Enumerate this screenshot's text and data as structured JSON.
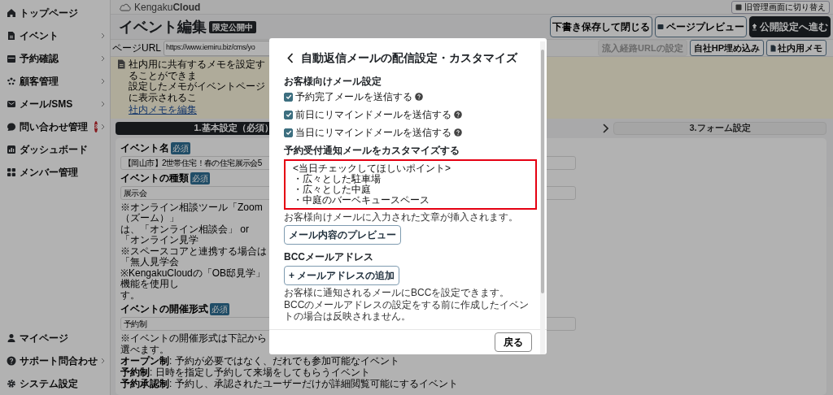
{
  "sidebar": {
    "items": [
      {
        "label": "トップページ",
        "expandable": false
      },
      {
        "label": "イベント",
        "expandable": true
      },
      {
        "label": "予約確認",
        "expandable": true
      },
      {
        "label": "顧客管理",
        "expandable": true
      },
      {
        "label": "メール/SMS",
        "expandable": true
      },
      {
        "label": "問い合わせ管理",
        "expandable": true,
        "badge": "3"
      },
      {
        "label": "ダッシュボード",
        "expandable": false
      },
      {
        "label": "メンバー管理",
        "expandable": false
      }
    ],
    "bottom_items": [
      {
        "label": "マイページ",
        "expandable": false
      },
      {
        "label": "サポート問合わせ",
        "expandable": true
      },
      {
        "label": "システム設定",
        "expandable": false
      }
    ]
  },
  "header": {
    "logo": "Kengaku**Cloud**",
    "switch_button": "旧管理画面に切り替え"
  },
  "page": {
    "title": "イベント編集",
    "status_badge": "限定公開中",
    "actions": [
      {
        "label": "下書き保存して閉じる",
        "kind": "outline"
      },
      {
        "label": "ページプレビュー",
        "kind": "preview"
      },
      {
        "label": "公開設定へ進む",
        "kind": "primary"
      }
    ],
    "url_label": "ページURL",
    "url": "https://www.iemiru.biz/cms/yo",
    "url_actions": [
      {
        "label": "流入経路URLの設定",
        "disabled": true,
        "kind": "plain"
      },
      {
        "label": "自社HP埋め込み",
        "disabled": false,
        "kind": "plain"
      },
      {
        "label": "社内用メモ",
        "disabled": false,
        "kind": "memo"
      }
    ]
  },
  "memo": {
    "lines": [
      "社内用に共有するメモを設定することができま",
      "設定したメモがイベントページに表示されるこ"
    ],
    "link": "社内メモを編集"
  },
  "steps": [
    {
      "label": "1.基本設定（必須）",
      "selected": true
    },
    {
      "label": "3.フォーム設定",
      "selected": false
    }
  ],
  "form": {
    "fields": [
      {
        "label": "イベント名",
        "badge": "必須",
        "value": "【岡山市】2世帯住宅！春の住宅展示会5"
      },
      {
        "label": "イベントの種類",
        "badge": "必須",
        "value": "展示会",
        "notes": [
          "※オンライン相談ツール「Zoom（ズーム）」",
          "は、「オンライン相談会」 or 「オンライン見学",
          "※スペースコアと連携する場合は「無人見学会",
          "※KengakuCloudの「OB邸見学」機能を使用し",
          "す。"
        ]
      },
      {
        "label": "イベントの開催形式",
        "badge": "必須",
        "value": "予約制",
        "intro": "※イベントの開催形式は下記から選べます。",
        "options": [
          "**オープン制**: 予約が必要ではなく、だれでも参加可能なイベント",
          "**予約制**: 日時を指定し予約して来場をしてもらうイベント",
          "**予約承認制**: 予約し、承認されたユーザーだけが詳細閲覧可能にするイベント"
        ]
      }
    ]
  },
  "modal": {
    "title": "自動返信メールの配信設定・カスタマイズ",
    "section_heading": "お客様向けメール設定",
    "checkboxes": [
      {
        "label": "予約完了メールを送信する",
        "checked": true
      },
      {
        "label": "前日にリマインドメールを送信する",
        "checked": true
      },
      {
        "label": "当日にリマインドメールを送信する",
        "checked": true
      }
    ],
    "custom_heading": "予約受付通知メールをカスタマイズする",
    "custom_text": [
      "<当日チェックしてほしいポイント>",
      "・広々とした駐車場",
      "・広々とした中庭",
      "・中庭のバーベキュースペース"
    ],
    "custom_highlighted": true,
    "custom_help": "お客様向けメールに入力された文章が挿入されます。",
    "preview_button": "メール内容のプレビュー",
    "bcc_heading": "BCCメールアドレス",
    "add_button": "+ メールアドレスの追加",
    "bcc_help": [
      "お客様に通知されるメールにBCCを設定できます。",
      "BCCのメールアドレスの設定をする前に作成したイベントの場合は反映されません。"
    ],
    "close_button": "戻る"
  }
}
